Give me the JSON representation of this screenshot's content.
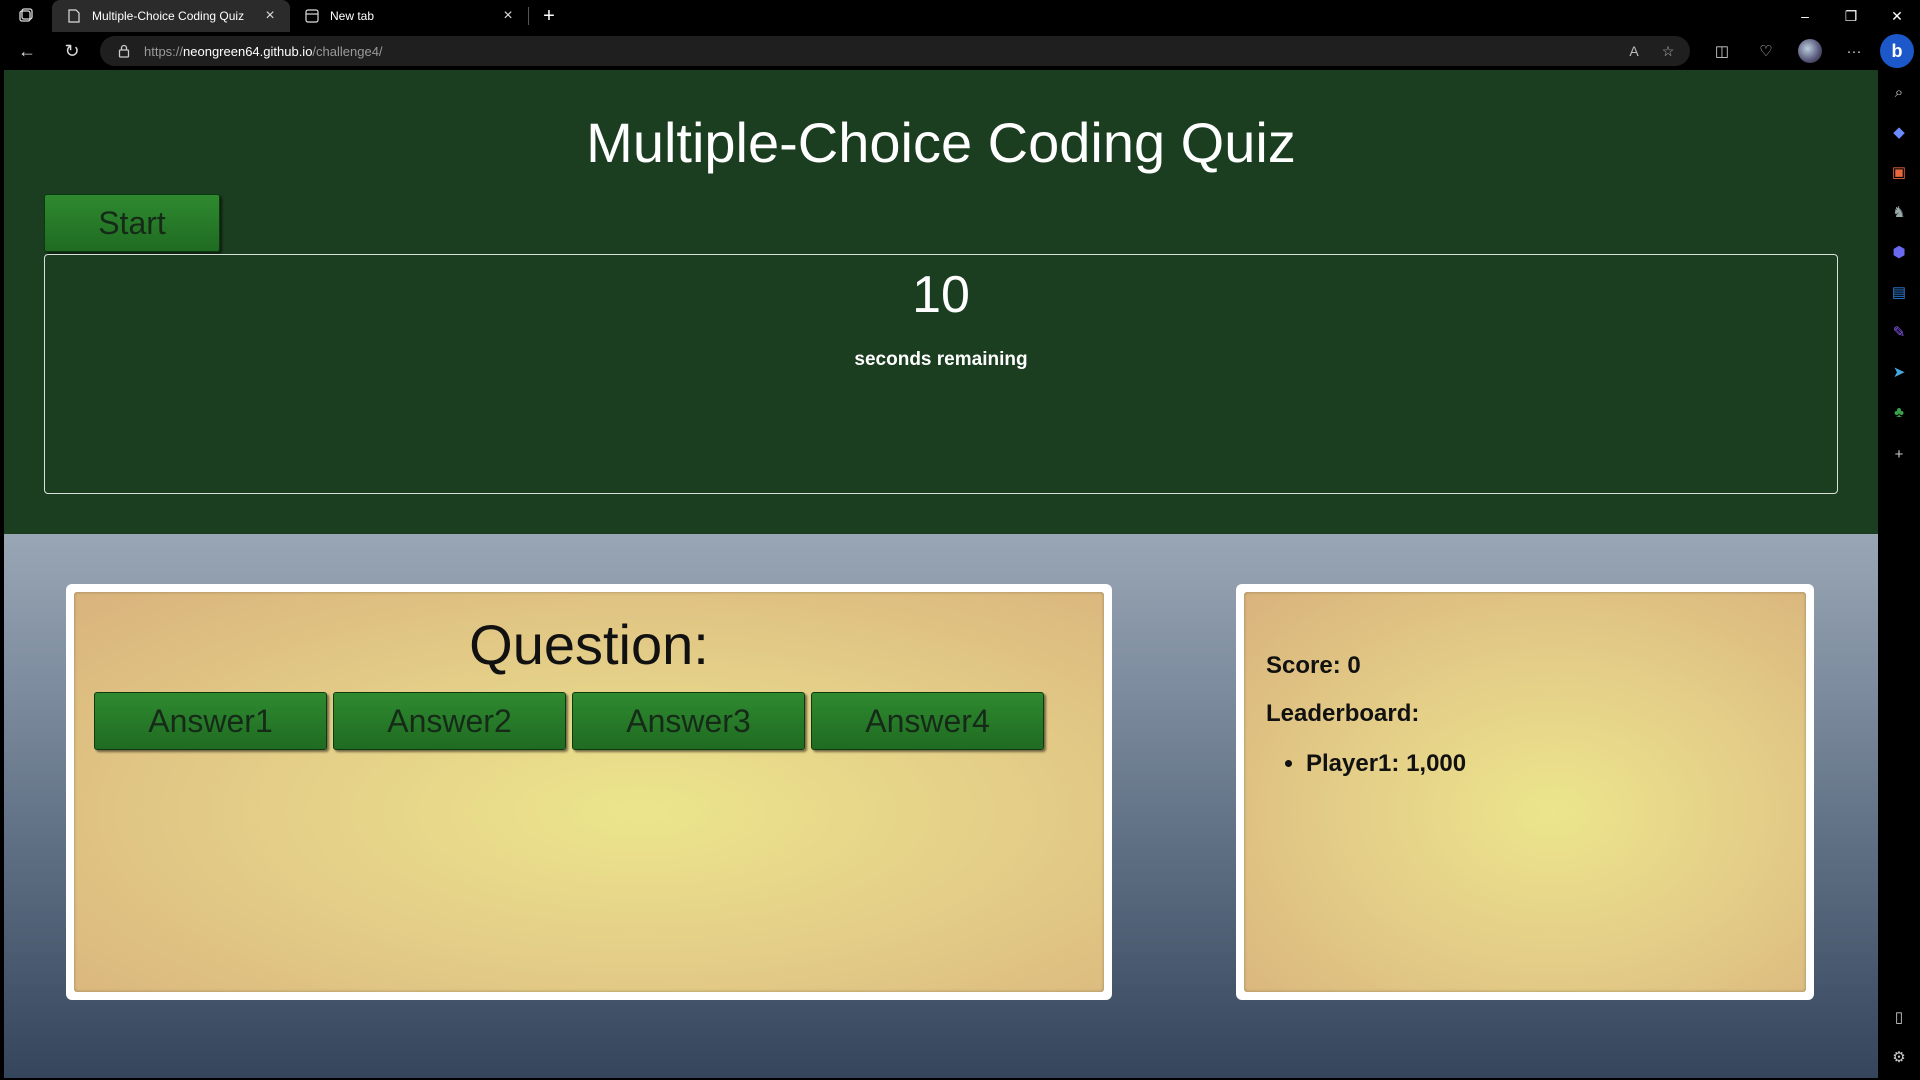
{
  "browser": {
    "tabs": [
      {
        "title": "Multiple-Choice Coding Quiz",
        "active": true
      },
      {
        "title": "New tab",
        "active": false
      }
    ],
    "url_scheme": "https://",
    "url_host": "neongreen64.github.io",
    "url_path": "/challenge4/"
  },
  "page": {
    "title": "Multiple-Choice Coding Quiz",
    "start_label": "Start",
    "timer": {
      "count": "10",
      "label": "seconds remaining"
    },
    "question": {
      "heading": "Question:",
      "answers": [
        "Answer1",
        "Answer2",
        "Answer3",
        "Answer4"
      ]
    },
    "scoreboard": {
      "score": "Score: 0",
      "leaderboard_label": "Leaderboard:",
      "entries": [
        "Player1: 1,000"
      ]
    }
  },
  "colors": {
    "header_bg": "#1b3d20",
    "button_green": "#2f8a2f",
    "card_bg": "#e4cf88"
  }
}
